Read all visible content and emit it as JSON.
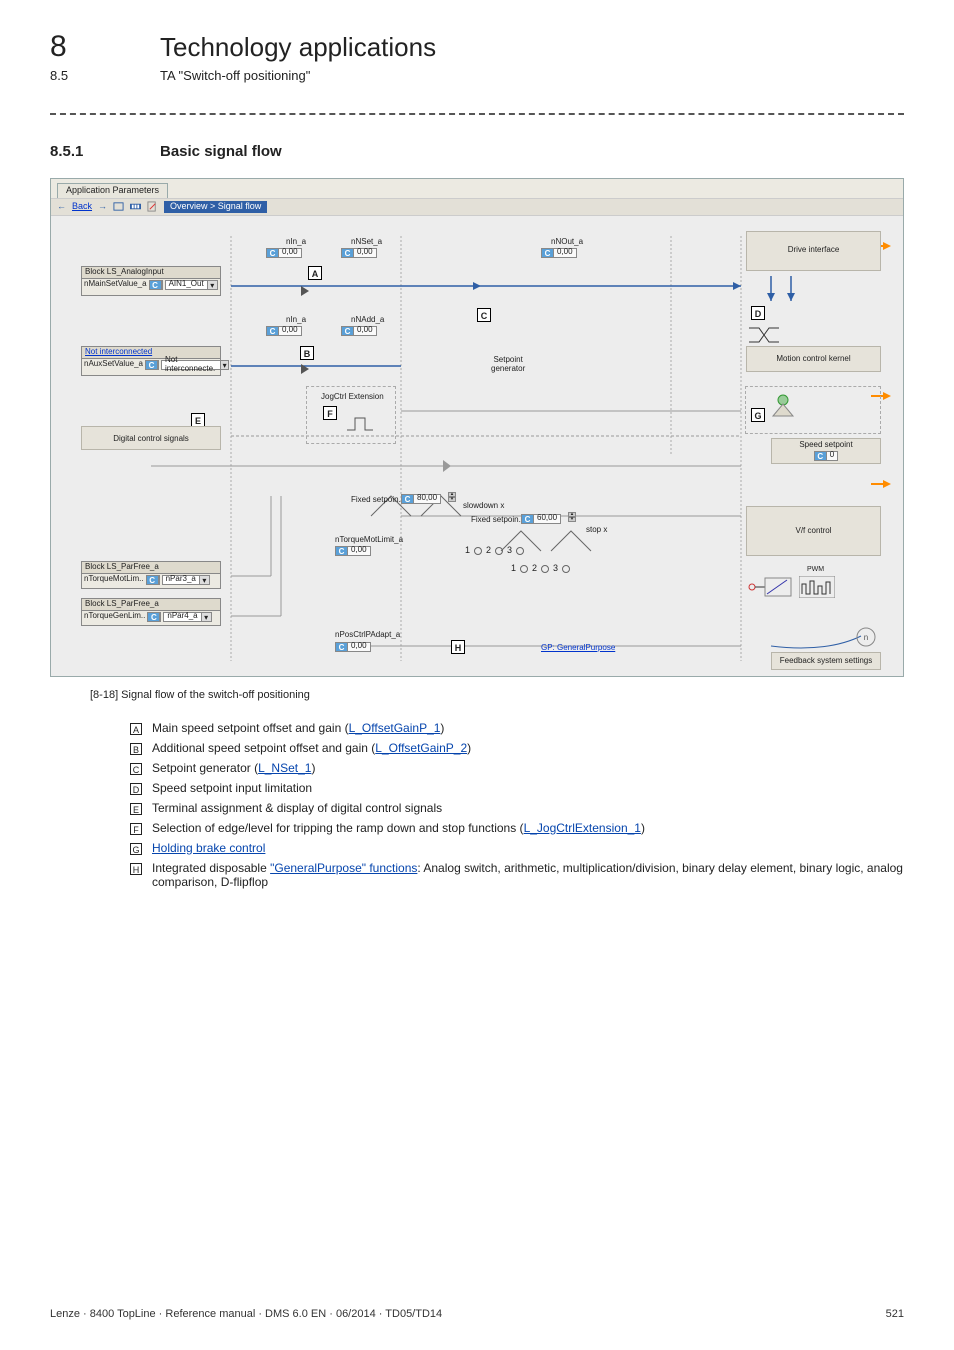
{
  "chapter": {
    "num": "8",
    "title": "Technology applications"
  },
  "subchapter": {
    "num": "8.5",
    "title": "TA \"Switch-off positioning\""
  },
  "section": {
    "num": "8.5.1",
    "title": "Basic signal flow"
  },
  "caption": "[8-18]   Signal flow of the switch-off positioning",
  "panel": {
    "tab": "Application Parameters",
    "back": "Back",
    "breadcrumb": "Overview > Signal flow",
    "labels": {
      "nIn_a_1": "nIn_a",
      "nNSet_a": "nNSet_a",
      "nNOut_a": "nNOut_a",
      "drive_interface": "Drive interface",
      "block_ls_analog": "Block LS_AnalogInput",
      "nMainSetValue_a": "nMainSetValue_a",
      "ain1_out": "AIN1_Out",
      "nIn_a_2": "nIn_a",
      "nNAdd_a": "nNAdd_a",
      "not_interconnected": "Not interconnected",
      "nAuxSetValue_a": "nAuxSetValue_a",
      "not_interconnecte_dd": "Not interconnecte.",
      "setpoint_generator": "Setpoint\ngenerator",
      "mck": "Motion control kernel",
      "jogctrl": "JogCtrl Extension",
      "digital_signals": "Digital control signals",
      "speed_setpoint": "Speed setpoint",
      "fixed_setpoin_1": "Fixed setpoin..",
      "slowdown_x": "slowdown x",
      "fixed_setpoin_2": "Fixed setpoin..",
      "stop_x": "stop x",
      "nTorqueMotLimit_a": "nTorqueMotLimit_a",
      "vf_control": "V/f control",
      "block_ls_parfree_a": "Block LS_ParFree_a",
      "nTorqueMotLim": "nTorqueMotLim..",
      "nPar3_a": "nPar3_a",
      "nTorqueGenLim": "nTorqueGenLim..",
      "nPar4_a": "nPar4_a",
      "nPosCtrlPAdapt_a": "nPosCtrlPAdapt_a",
      "gp_general": "GP: GeneralPurpose",
      "feedback": "Feedback system settings",
      "pwm": "PWM"
    },
    "values": {
      "v000_1": "0,00",
      "v000_2": "0,00",
      "v000_3": "0,00",
      "v000_4": "0,00",
      "v000_5": "0,00",
      "v000_6": "0,00",
      "v8000": "80,00",
      "v6000": "60,00",
      "v000_7": "0,00",
      "v0": "0"
    }
  },
  "legend": [
    {
      "mark": "A",
      "text_pre": "Main speed setpoint offset and gain (",
      "link": "L_OffsetGainP_1",
      "text_post": ")"
    },
    {
      "mark": "B",
      "text_pre": "Additional speed setpoint offset and gain (",
      "link": "L_OffsetGainP_2",
      "text_post": ")"
    },
    {
      "mark": "C",
      "text_pre": "Setpoint generator (",
      "link": "L_NSet_1",
      "text_post": ")"
    },
    {
      "mark": "D",
      "text_pre": "Speed setpoint input limitation",
      "link": "",
      "text_post": ""
    },
    {
      "mark": "E",
      "text_pre": "Terminal assignment & display of digital control signals",
      "link": "",
      "text_post": ""
    },
    {
      "mark": "F",
      "text_pre": "Selection of edge/level for tripping the ramp down and stop functions (",
      "link": "L_JogCtrlExtension_1",
      "text_post": ")"
    },
    {
      "mark": "G",
      "text_pre": "",
      "link": "Holding brake control",
      "text_post": ""
    },
    {
      "mark": "H",
      "text_pre": "Integrated disposable ",
      "link": "\"GeneralPurpose\" functions",
      "text_post": ": Analog switch, arithmetic, multiplication/division, binary delay element, binary logic, analog comparison, D-flipflop"
    }
  ],
  "footer": {
    "left": "Lenze · 8400 TopLine · Reference manual · DMS 6.0 EN · 06/2014 · TD05/TD14",
    "right": "521"
  }
}
